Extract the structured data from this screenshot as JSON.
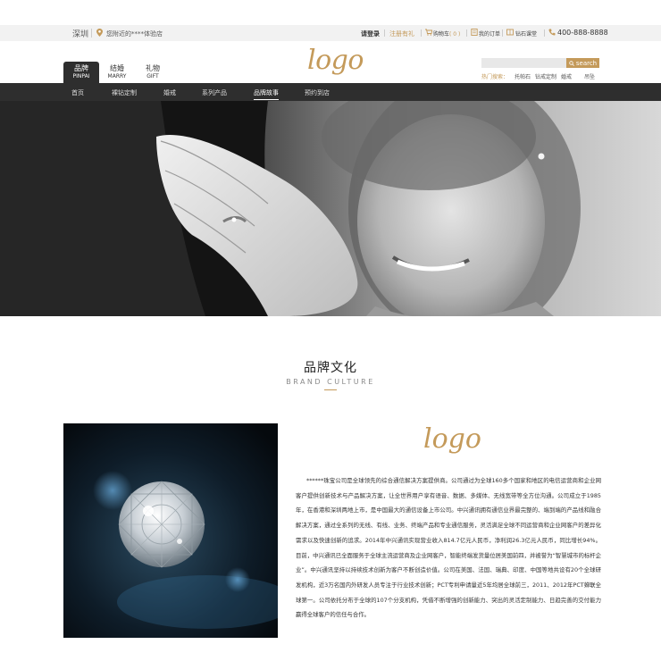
{
  "colors": {
    "accent": "#c49a5a",
    "dark": "#2e2e2e",
    "topbar": "#f2f2f2"
  },
  "topbar": {
    "city": "深圳",
    "nearby": "您附近的****体验店",
    "login": "请登录",
    "register": "注册有礼",
    "cart_label": "购物车",
    "cart_count": "( 0 )",
    "orders": "我的订单",
    "classroom": "钻石课堂",
    "phone": "400-888-8888",
    "icons": [
      "location-icon",
      "cart-icon",
      "orders-icon",
      "classroom-icon",
      "phone-icon"
    ]
  },
  "header": {
    "logo": "logo",
    "tabs": [
      {
        "cn": "品牌",
        "en": "PINPAI"
      },
      {
        "cn": "结婚",
        "en": "MARRY"
      },
      {
        "cn": "礼物",
        "en": "GIFT"
      }
    ],
    "search_placeholder": "",
    "search_button": "search",
    "hot_label": "热门搜索：",
    "hot_items": [
      "托帕石",
      "钻戒定制",
      "婚戒",
      "吊坠"
    ]
  },
  "nav": {
    "items": [
      "首页",
      "裸钻定制",
      "婚戒",
      "系列产品",
      "品牌故事",
      "预约到店"
    ],
    "active_index": 4
  },
  "section": {
    "title": "品牌文化",
    "subtitle": "BRAND CULTURE",
    "logo": "logo",
    "paragraph": "******珠宝公司是全球领先的综合通信解决方案提供商。公司通过为全球160多个国家和地区的电信运营商和企业网客户提供创新技术与产品解决方案，让全世界用户享有语音、数据、多媒体、无线宽带等全方位沟通。公司成立于1985年，在香港和深圳两地上市，是中国最大的通信设备上市公司。中兴通讯拥有通信业界最完整的、端到端的产品线和融合解决方案，通过全系列的无线、有线、业务、终端产品和专业通信服务，灵活满足全球不同运营商和企业网客户的差异化需求以及快速创新的追求。2014年中兴通讯实现营业收入814.7亿元人民币，净利润26.3亿元人民币，同比增长94%。目前，中兴通讯已全面服务于全球主流运营商及企业网客户，智能终端发货量位居美国前四，并被誉为“智慧城市的标杆企业”。中兴通讯坚持以持续技术创新为客户不断创造价值。公司在美国、法国、瑞典、印度、中国等地共设有20个全球研发机构，近3万名国内外研发人员专注于行业技术创新；PCT专利申请量近5年均居全球前三，2011、2012年PCT蝉联全球第一。公司依托分布于全球的107个分支机构，凭借不断增强的创新能力、突出的灵活定制能力、日趋完善的交付能力赢得全球客户的信任与合作。"
  }
}
